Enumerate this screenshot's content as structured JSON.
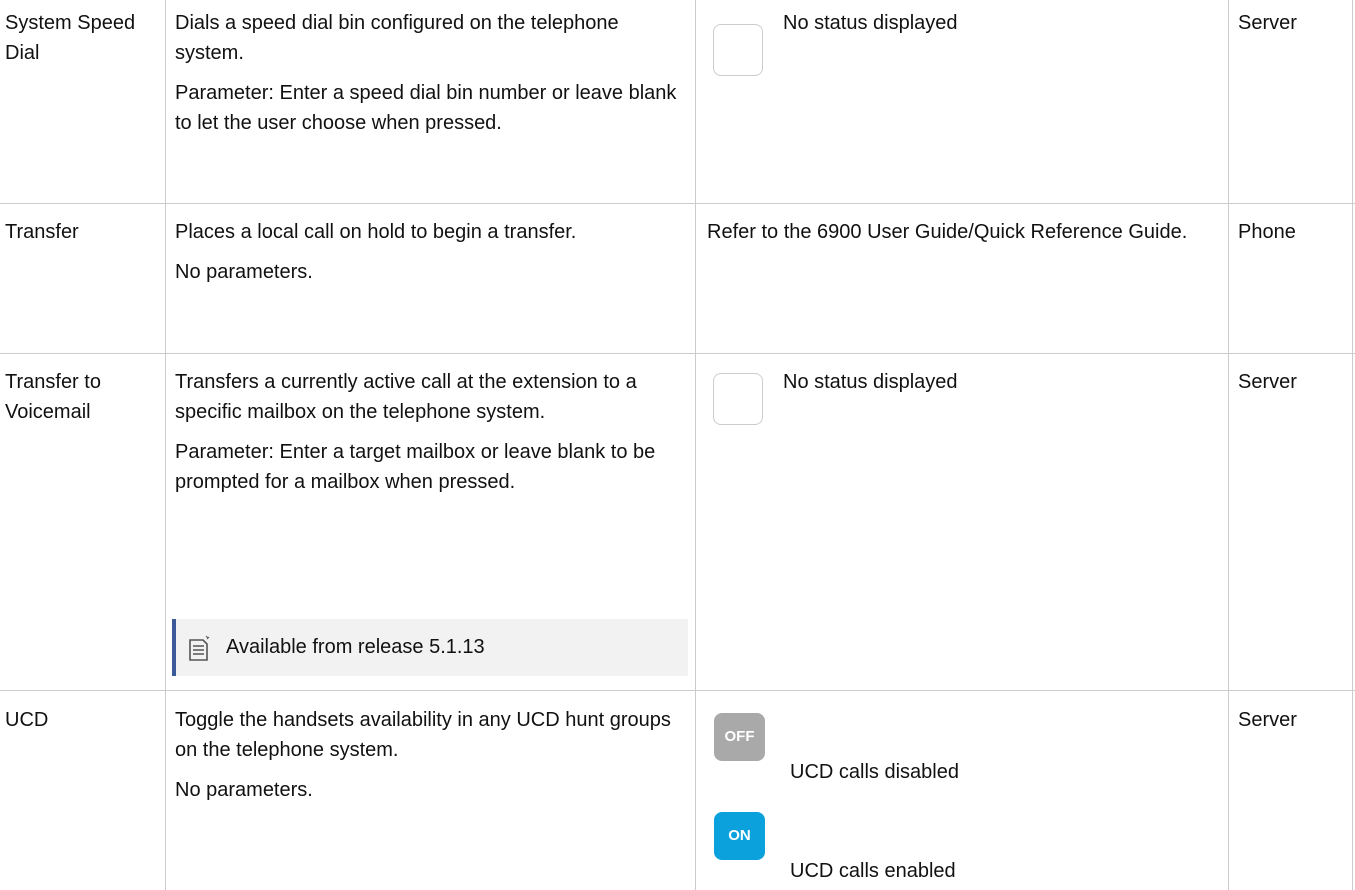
{
  "rows": [
    {
      "name": "System Speed Dial",
      "description": [
        "Dials a speed dial bin configured on the telephone system.",
        "Parameter: Enter a speed dial bin number or leave blank to let the user choose when pressed."
      ],
      "status_text": "No status displayed",
      "location": "Server"
    },
    {
      "name": "Transfer",
      "description": [
        "Places a local call on hold to begin a transfer.",
        "No parameters."
      ],
      "status_text": "Refer to the 6900 User Guide/Quick Reference Guide.",
      "location": "Phone"
    },
    {
      "name": "Transfer to Voicemail",
      "description": [
        "Transfers a currently active call at the extension to a specific mailbox on the telephone system.",
        "Parameter: Enter a target mailbox or leave blank to be prompted for a mailbox when pressed."
      ],
      "note": "Available from release 5.1.13",
      "status_text": "No status displayed",
      "location": "Server"
    },
    {
      "name": "UCD",
      "description": [
        "Toggle the handsets availability in any UCD hunt groups on the telephone system.",
        "No parameters."
      ],
      "statuses": [
        {
          "badge": "OFF",
          "label": "UCD calls disabled",
          "color": "#a9a9a9"
        },
        {
          "badge": "ON",
          "label": "UCD calls enabled",
          "color": "#0aa1dd"
        }
      ],
      "location": "Server"
    }
  ],
  "colors": {
    "border": "#cccccc",
    "note_accent": "#3c5a9a",
    "note_bg": "#f2f2f2"
  },
  "icons": {
    "note": "note-icon",
    "status": "blank-status-icon"
  }
}
